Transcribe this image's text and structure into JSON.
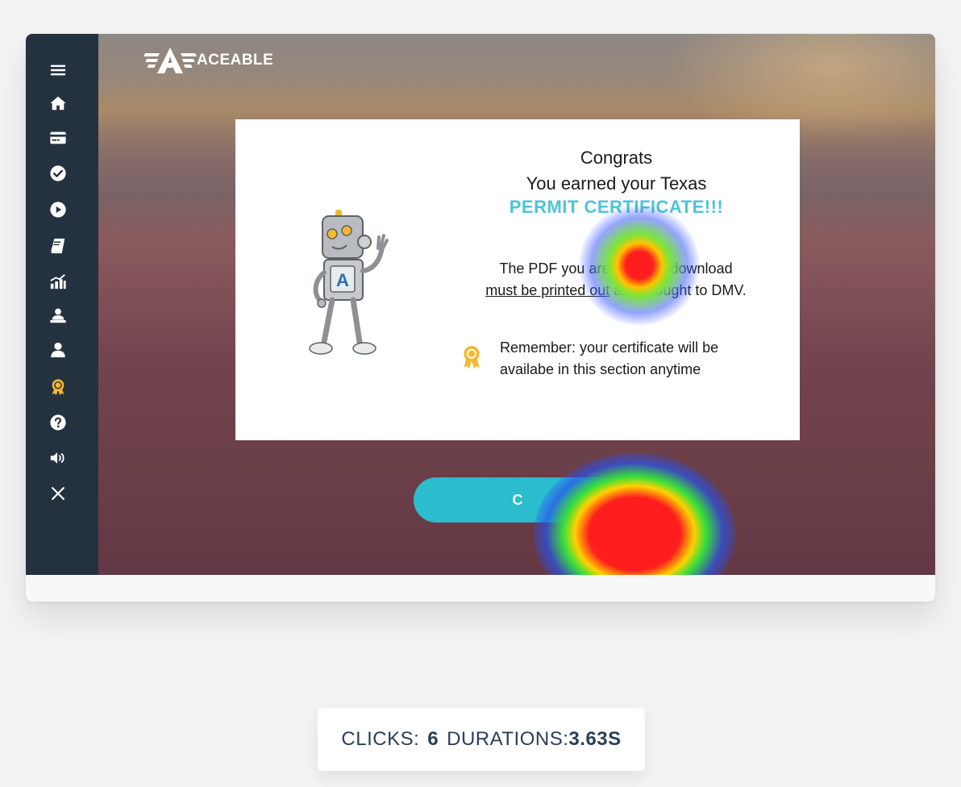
{
  "brand": {
    "name": "ACEABLE"
  },
  "sidebar": {
    "items": [
      {
        "icon": "menu-icon",
        "active": false
      },
      {
        "icon": "home-icon",
        "active": false
      },
      {
        "icon": "credit-card-icon",
        "active": false
      },
      {
        "icon": "check-circle-icon",
        "active": false
      },
      {
        "icon": "play-circle-icon",
        "active": false
      },
      {
        "icon": "book-icon",
        "active": false
      },
      {
        "icon": "chart-bar-icon",
        "active": false
      },
      {
        "icon": "student-desk-icon",
        "active": false
      },
      {
        "icon": "user-icon",
        "active": false
      },
      {
        "icon": "certificate-badge-icon",
        "active": true
      },
      {
        "icon": "help-circle-icon",
        "active": false
      },
      {
        "icon": "volume-icon",
        "active": false
      },
      {
        "icon": "close-icon",
        "active": false
      }
    ],
    "active_color": "#f5b82e"
  },
  "modal": {
    "line1": "Congrats",
    "line2": "You earned your Texas",
    "highlight": "PERMIT CERTIFICATE!!!",
    "pdf_prefix": "The PDF you are about to download",
    "pdf_underlined": "must be printed out",
    "pdf_suffix": " and brought to DMV.",
    "remember_line1": "Remember: your certificate will be",
    "remember_line2": "availabe in this section anytime"
  },
  "cta": {
    "label": "C"
  },
  "stats": {
    "clicks_label": "CLICKS:",
    "clicks_value": "6",
    "durations_label": "DURATIONS:",
    "durations_value": "3.63S"
  },
  "colors": {
    "sidebar_bg": "#243240",
    "accent": "#4ec3d6",
    "button": "#2bbccd",
    "stats_text": "#2c3e55"
  }
}
